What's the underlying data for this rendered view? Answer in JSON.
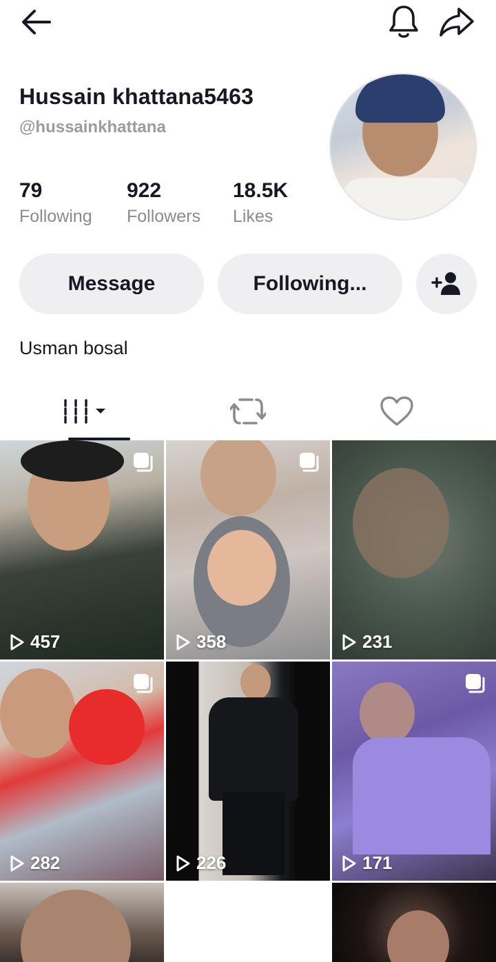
{
  "profile": {
    "name": "Hussain khattana5463",
    "handle": "@hussainkhattana",
    "bio": "Usman bosal"
  },
  "stats": {
    "following": {
      "value": "79",
      "label": "Following"
    },
    "followers": {
      "value": "922",
      "label": "Followers"
    },
    "likes": {
      "value": "18.5K",
      "label": "Likes"
    }
  },
  "actions": {
    "message_label": "Message",
    "following_label": "Following..."
  },
  "videos": [
    {
      "views": "457",
      "multi": true
    },
    {
      "views": "358",
      "multi": true
    },
    {
      "views": "231",
      "multi": false
    },
    {
      "views": "282",
      "multi": true
    },
    {
      "views": "226",
      "multi": false
    },
    {
      "views": "171",
      "multi": true
    }
  ],
  "icons": {
    "back": "arrow-left-icon",
    "notifications": "bell-icon",
    "share": "share-arrow-icon",
    "add_friend": "add-person-icon",
    "videos_tab": "grid-bars-icon",
    "reposts_tab": "repost-icon",
    "liked_tab": "heart-icon",
    "play": "play-outline-icon",
    "multi": "stacked-squares-icon"
  },
  "colors": {
    "text": "#161823",
    "muted": "#8a8b91",
    "pill_bg": "#efeff1"
  }
}
